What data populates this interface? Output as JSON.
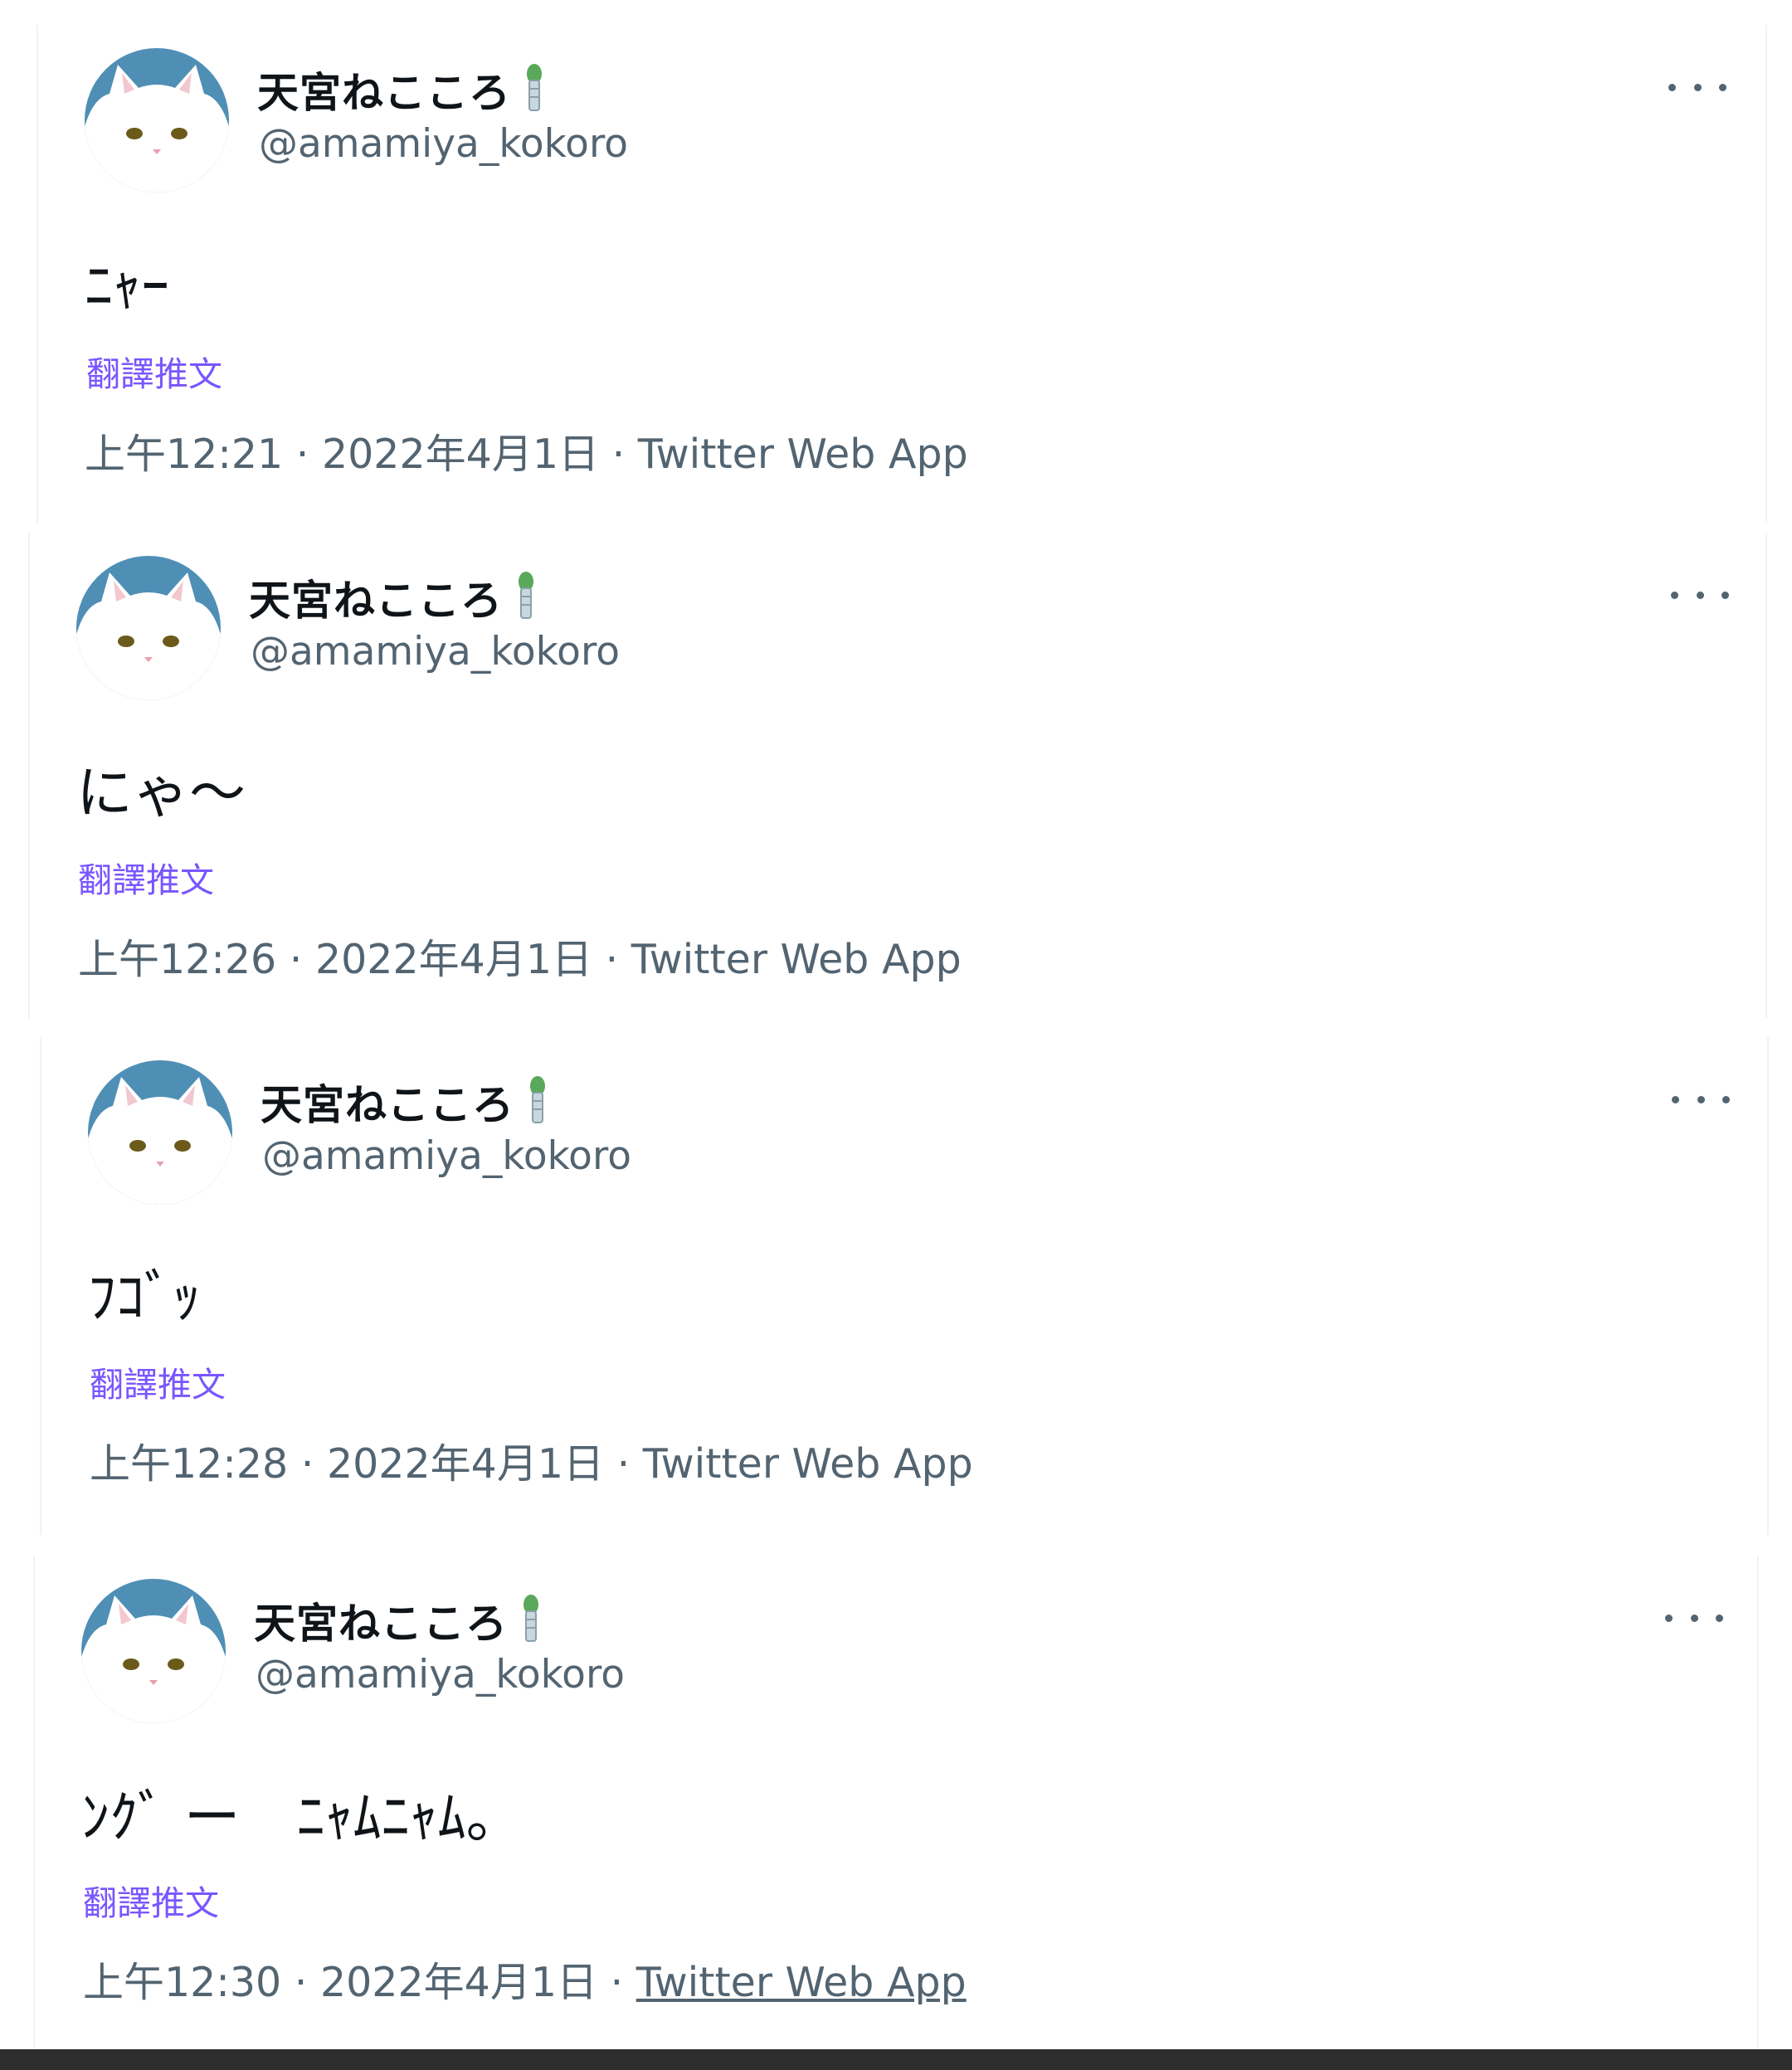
{
  "tweets": [
    {
      "display_name": "天宮ねこころ",
      "handle": "@amamiya_kokoro",
      "text": "ﾆｬｰ",
      "translate_label": "翻譯推文",
      "time": "上午12:21",
      "date": "2022年4月1日",
      "source": "Twitter Web App"
    },
    {
      "display_name": "天宮ねこころ",
      "handle": "@amamiya_kokoro",
      "text": "にゃ〜",
      "translate_label": "翻譯推文",
      "time": "上午12:26",
      "date": "2022年4月1日",
      "source": "Twitter Web App"
    },
    {
      "display_name": "天宮ねこころ",
      "handle": "@amamiya_kokoro",
      "text": "ﾌｺﾞｯ",
      "translate_label": "翻譯推文",
      "time": "上午12:28",
      "date": "2022年4月1日",
      "source": "Twitter Web App"
    },
    {
      "display_name": "天宮ねこころ",
      "handle": "@amamiya_kokoro",
      "text": "ﾝｸﾞ ー　ﾆｬﾑﾆｬﾑ。",
      "translate_label": "翻譯推文",
      "time": "上午12:30",
      "date": "2022年4月1日",
      "source": "Twitter Web App"
    }
  ],
  "separator": " · ",
  "icons": {
    "avatar": "white-cat-avatar",
    "badge": "green-bell-badge-icon",
    "more": "more-options-icon"
  },
  "colors": {
    "secondary_text": "#536471",
    "translate_link": "#7856ff",
    "avatar_bg": "#4f8fb5",
    "badge_green": "#5aa85a"
  }
}
